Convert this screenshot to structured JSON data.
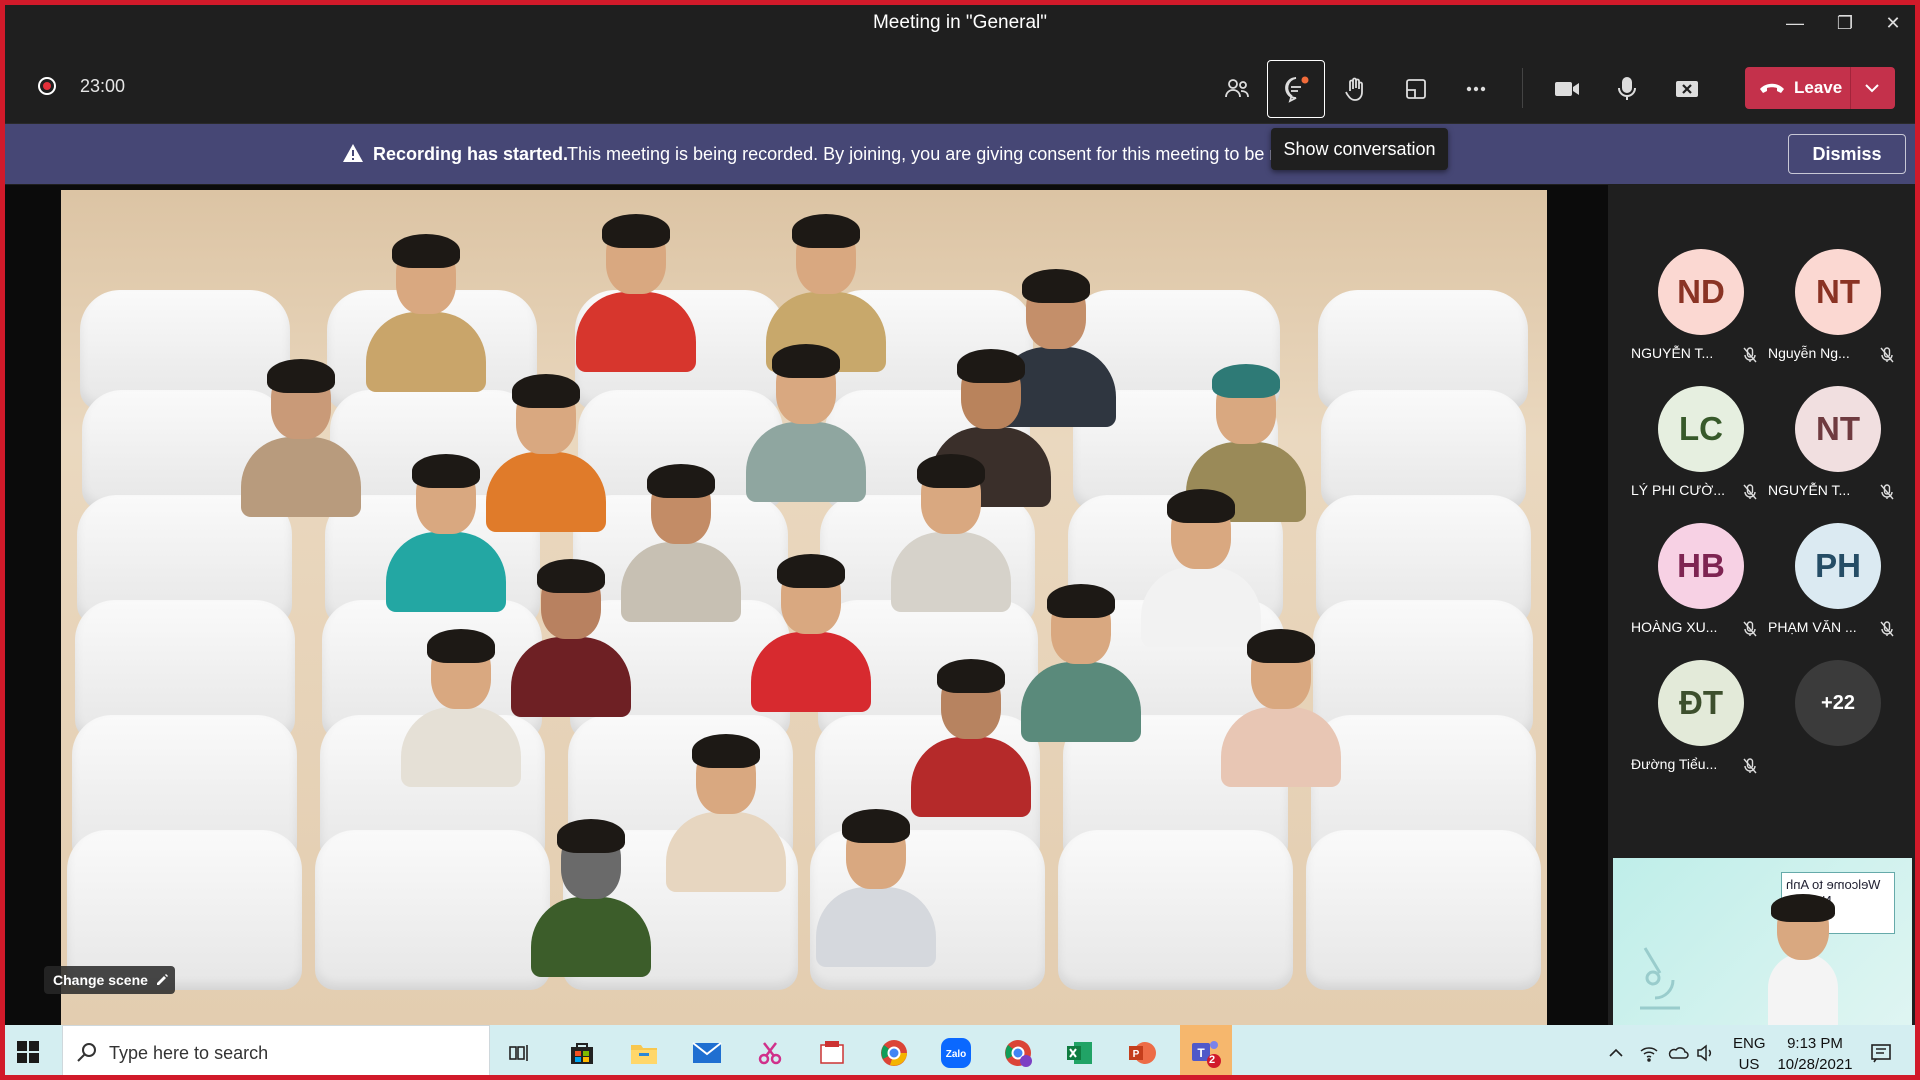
{
  "window": {
    "title": "Meeting in \"General\"",
    "minimize": "—",
    "restore": "❐",
    "close": "✕"
  },
  "toolbar": {
    "timer": "23:00",
    "leave_label": "Leave"
  },
  "banner": {
    "bold": "Recording has started.",
    "message": "This meeting is being recorded. By joining, you are giving consent for this meeting to be recorded.",
    "dismiss": "Dismiss"
  },
  "tooltip": "Show conversation",
  "stage": {
    "change_scene": "Change scene"
  },
  "participants": [
    {
      "initials": "ND",
      "name": "NGUYỄN T...",
      "bg": "#fbd8d2",
      "fg": "#8a3324"
    },
    {
      "initials": "NT",
      "name": "Nguyễn Ng...",
      "bg": "#fbd8d2",
      "fg": "#8a3324"
    },
    {
      "initials": "LC",
      "name": "LÝ PHI CƯỜ...",
      "bg": "#e6efe0",
      "fg": "#37592a"
    },
    {
      "initials": "NT",
      "name": "NGUYỄN T...",
      "bg": "#f1dfe0",
      "fg": "#6f3b40"
    },
    {
      "initials": "HB",
      "name": "HOÀNG XU...",
      "bg": "#f7d1e4",
      "fg": "#7e2452"
    },
    {
      "initials": "PH",
      "name": "PHẠM VĂN ...",
      "bg": "#dbeaf2",
      "fg": "#254d66"
    },
    {
      "initials": "ĐT",
      "name": "Đường Tiểu...",
      "bg": "#e3ead9",
      "fg": "#3d4f2d"
    }
  ],
  "overflow_count": "+22",
  "self_view": {
    "sign": "Welcome to Anh Ngu PH"
  },
  "taskbar": {
    "search_placeholder": "Type here to search",
    "lang_top": "ENG",
    "lang_bottom": "US",
    "time": "9:13 PM",
    "date": "10/28/2021",
    "teams_badge": "2"
  },
  "colors": {
    "banner": "#464775",
    "leave": "#c4314b",
    "frame": "#d11a2a",
    "taskbar": "#d4eef1"
  }
}
